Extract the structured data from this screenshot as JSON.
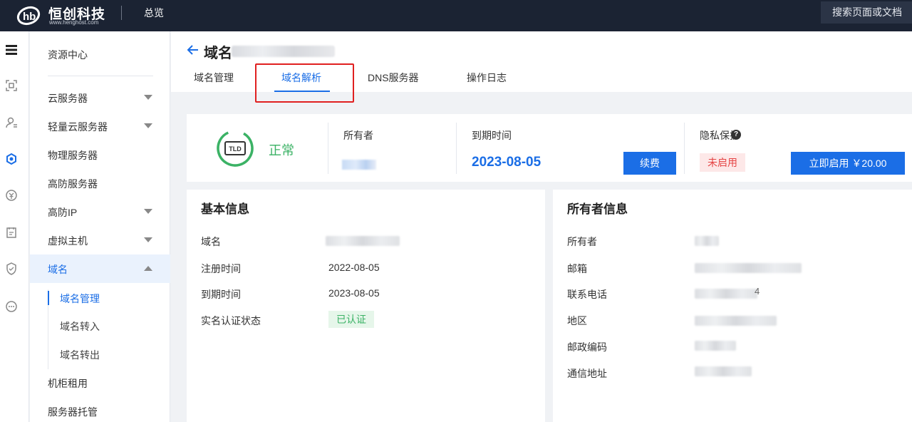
{
  "topbar": {
    "brand_name": "恒创科技",
    "brand_url": "www.henghost.com",
    "overview": "总览",
    "search_placeholder": "搜索页面或文档"
  },
  "sidebar": {
    "title": "资源中心",
    "items": [
      {
        "label": "云服务器",
        "expandable": true
      },
      {
        "label": "轻量云服务器",
        "expandable": true
      },
      {
        "label": "物理服务器",
        "expandable": false
      },
      {
        "label": "高防服务器",
        "expandable": false
      },
      {
        "label": "高防IP",
        "expandable": true
      },
      {
        "label": "虚拟主机",
        "expandable": true
      },
      {
        "label": "域名",
        "expandable": true,
        "expanded": true
      }
    ],
    "sub_items": [
      "域名管理",
      "域名转入",
      "域名转出"
    ],
    "more_items": [
      "机柜租用",
      "服务器托管"
    ]
  },
  "header": {
    "title": "域名",
    "tabs": [
      "域名管理",
      "域名解析",
      "DNS服务器",
      "操作日志"
    ],
    "active_tab": "域名解析"
  },
  "status_card": {
    "icon_text": "TLD",
    "status": "正常",
    "owner_label": "所有者",
    "expire_label": "到期时间",
    "expire_date": "2023-08-05",
    "renew_button": "续费",
    "privacy_label": "隐私保护",
    "privacy_help": "?",
    "privacy_state": "未启用",
    "enable_button": "立即启用 ￥20.00"
  },
  "basic_info": {
    "title": "基本信息",
    "rows": [
      {
        "label": "域名",
        "value": ""
      },
      {
        "label": "注册时间",
        "value": "2022-08-05"
      },
      {
        "label": "到期时间",
        "value": "2023-08-05"
      },
      {
        "label": "实名认证状态",
        "value": "已认证"
      }
    ]
  },
  "owner_info": {
    "title": "所有者信息",
    "rows": [
      {
        "label": "所有者"
      },
      {
        "label": "邮箱"
      },
      {
        "label": "联系电话",
        "value_suffix": "4"
      },
      {
        "label": "地区"
      },
      {
        "label": "邮政编码"
      },
      {
        "label": "通信地址"
      }
    ]
  },
  "colors": {
    "accent": "#1b6ee6",
    "topbar": "#1b2333",
    "success": "#3bb265",
    "danger": "#e54545",
    "highlight": "#e02020"
  }
}
